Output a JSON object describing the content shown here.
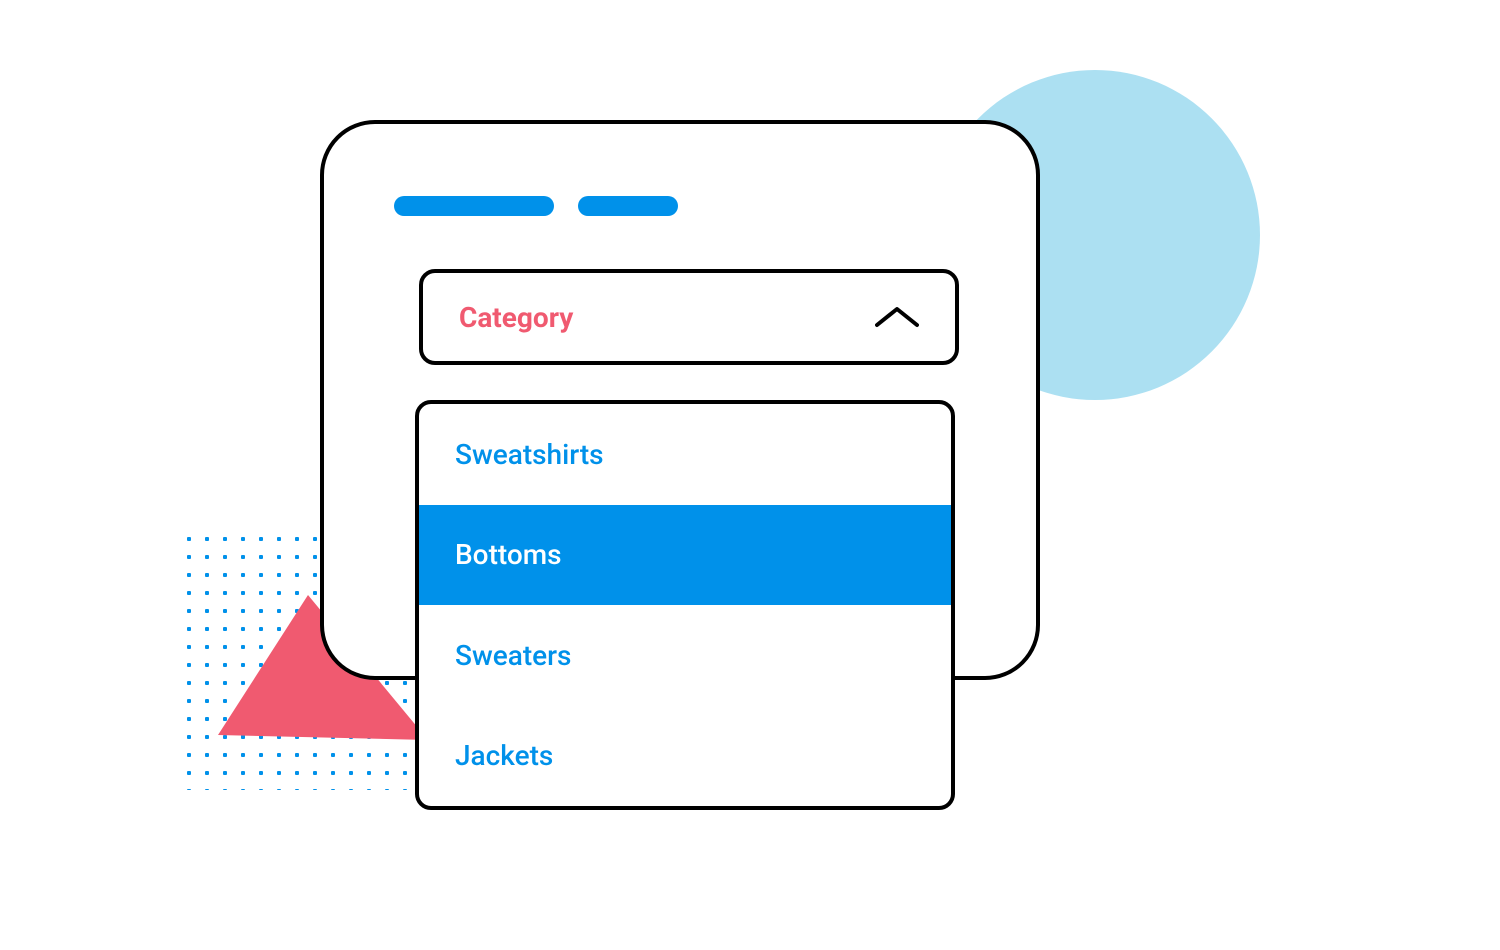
{
  "colors": {
    "accentBlue": "#0091ea",
    "accentPink": "#f05a70",
    "lightBlue": "#ace0f2",
    "border": "#000000"
  },
  "dropdown": {
    "label": "Category",
    "selectedIndex": 1,
    "options": [
      {
        "label": "Sweatshirts"
      },
      {
        "label": "Bottoms"
      },
      {
        "label": "Sweaters"
      },
      {
        "label": "Jackets"
      }
    ]
  }
}
